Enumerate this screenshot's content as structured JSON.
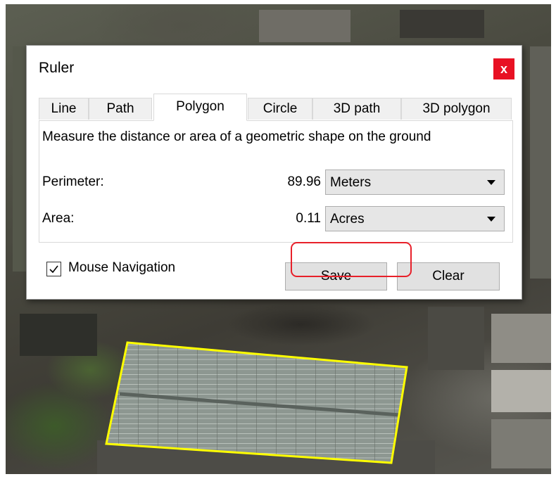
{
  "dialog": {
    "title": "Ruler",
    "close_label": "x",
    "tabs": [
      {
        "label": "Line"
      },
      {
        "label": "Path"
      },
      {
        "label": "Polygon",
        "active": true
      },
      {
        "label": "Circle"
      },
      {
        "label": "3D path"
      },
      {
        "label": "3D polygon"
      }
    ],
    "description": "Measure the distance or area of a geometric shape on the ground",
    "perimeter": {
      "label": "Perimeter:",
      "value": "89.96",
      "unit": "Meters"
    },
    "area": {
      "label": "Area:",
      "value": "0.11",
      "unit": "Acres"
    },
    "mouse_navigation": {
      "label": "Mouse Navigation",
      "checked": true
    },
    "save_label": "Save",
    "clear_label": "Clear"
  },
  "colors": {
    "close_button": "#e81123",
    "highlight_outline": "#e8202a",
    "polygon_outline": "#ffff00"
  }
}
